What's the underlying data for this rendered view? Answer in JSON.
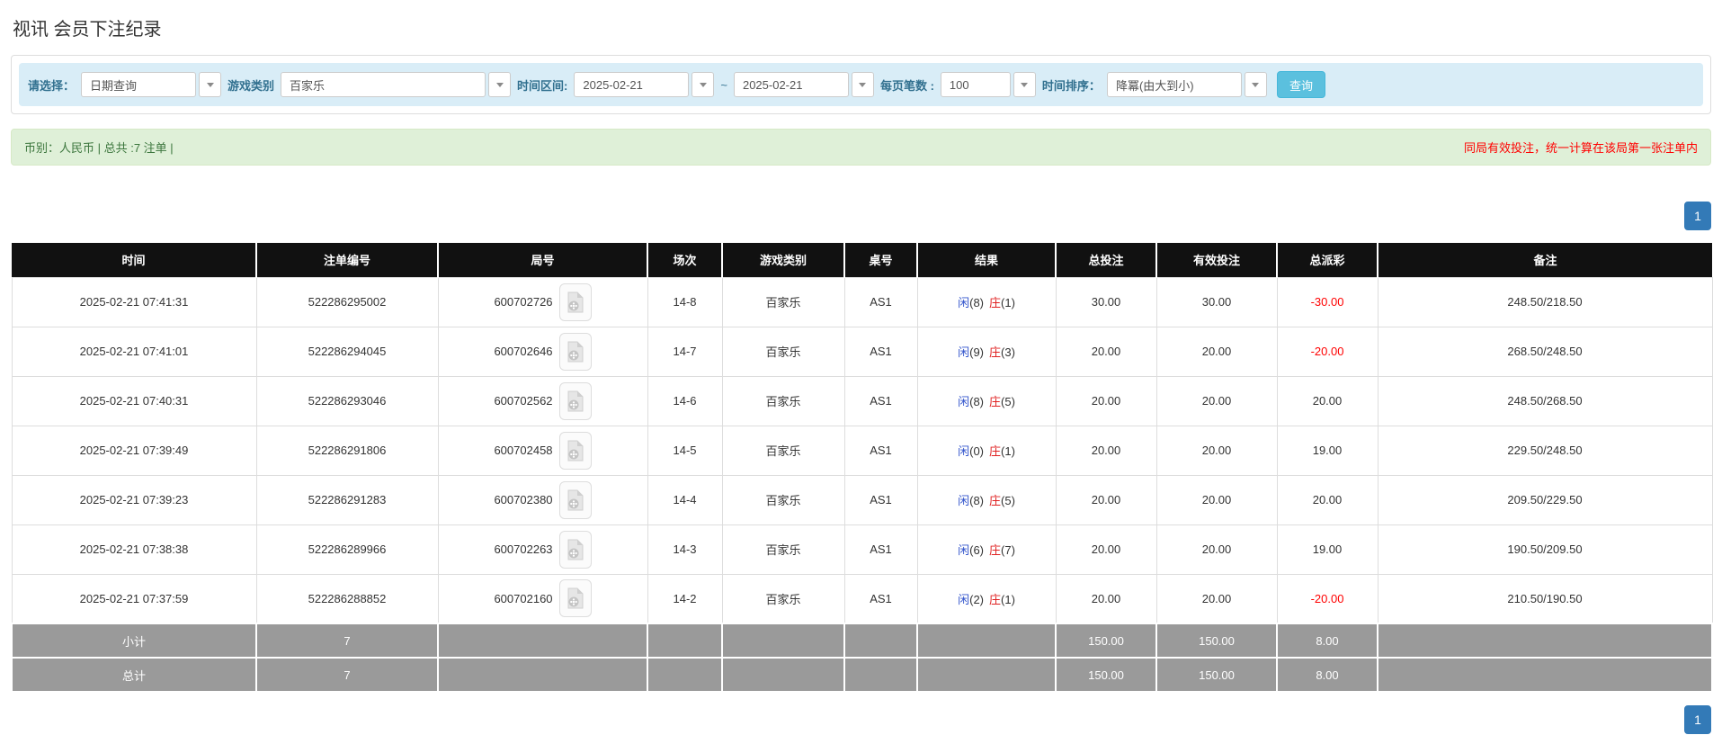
{
  "page": {
    "title": "视讯 会员下注纪录"
  },
  "filters": {
    "select_label": "请选择：",
    "select_value": "日期查询",
    "game_type_label": "游戏类别",
    "game_type_value": "百家乐",
    "time_range_label": "时间区间:",
    "date_from": "2025-02-21",
    "range_separator": "~",
    "date_to": "2025-02-21",
    "page_size_label": "每页笔数 :",
    "page_size_value": "100",
    "sort_label": "时间排序：",
    "sort_value": "降冪(由大到小)",
    "search_button": "查询"
  },
  "summary": {
    "left_text": "币别：人民币 | 总共 :7 注单 |",
    "right_notice": "同局有效投注，统一计算在该局第一张注单内"
  },
  "pagination": {
    "page": "1"
  },
  "colors": {
    "filter_bg": "#d9edf7",
    "filter_label": "#31708f",
    "search_button": "#5bc0de",
    "summary_bg": "#dff0d8",
    "summary_text": "#3c763d",
    "notice_red": "#ff0000",
    "header_bg": "#111111",
    "footer_bg": "#9a9a9a",
    "pager_blue": "#337ab7",
    "bet_amount_blue": "#1d7de2",
    "player_blue": "#3355cc",
    "banker_red": "#e02222",
    "negative_red": "#ff0000"
  },
  "table": {
    "headers": [
      "时间",
      "注单编号",
      "局号",
      "场次",
      "游戏类别",
      "桌号",
      "结果",
      "总投注",
      "有效投注",
      "总派彩",
      "备注"
    ],
    "rows": [
      {
        "time": "2025-02-21 07:41:31",
        "bet_id": "522286295002",
        "round_id": "600702726",
        "session": "14-8",
        "game": "百家乐",
        "table_no": "AS1",
        "p_label": "闲",
        "p_num": "(8)",
        "b_label": "庄",
        "b_num": "(1)",
        "total_bet": "30.00",
        "valid_bet": "30.00",
        "payout": "-30.00",
        "note": "248.50/218.50"
      },
      {
        "time": "2025-02-21 07:41:01",
        "bet_id": "522286294045",
        "round_id": "600702646",
        "session": "14-7",
        "game": "百家乐",
        "table_no": "AS1",
        "p_label": "闲",
        "p_num": "(9)",
        "b_label": "庄",
        "b_num": "(3)",
        "total_bet": "20.00",
        "valid_bet": "20.00",
        "payout": "-20.00",
        "note": "268.50/248.50"
      },
      {
        "time": "2025-02-21 07:40:31",
        "bet_id": "522286293046",
        "round_id": "600702562",
        "session": "14-6",
        "game": "百家乐",
        "table_no": "AS1",
        "p_label": "闲",
        "p_num": "(8)",
        "b_label": "庄",
        "b_num": "(5)",
        "total_bet": "20.00",
        "valid_bet": "20.00",
        "payout": "20.00",
        "note": "248.50/268.50"
      },
      {
        "time": "2025-02-21 07:39:49",
        "bet_id": "522286291806",
        "round_id": "600702458",
        "session": "14-5",
        "game": "百家乐",
        "table_no": "AS1",
        "p_label": "闲",
        "p_num": "(0)",
        "b_label": "庄",
        "b_num": "(1)",
        "total_bet": "20.00",
        "valid_bet": "20.00",
        "payout": "19.00",
        "note": "229.50/248.50"
      },
      {
        "time": "2025-02-21 07:39:23",
        "bet_id": "522286291283",
        "round_id": "600702380",
        "session": "14-4",
        "game": "百家乐",
        "table_no": "AS1",
        "p_label": "闲",
        "p_num": "(8)",
        "b_label": "庄",
        "b_num": "(5)",
        "total_bet": "20.00",
        "valid_bet": "20.00",
        "payout": "20.00",
        "note": "209.50/229.50"
      },
      {
        "time": "2025-02-21 07:38:38",
        "bet_id": "522286289966",
        "round_id": "600702263",
        "session": "14-3",
        "game": "百家乐",
        "table_no": "AS1",
        "p_label": "闲",
        "p_num": "(6)",
        "b_label": "庄",
        "b_num": "(7)",
        "total_bet": "20.00",
        "valid_bet": "20.00",
        "payout": "19.00",
        "note": "190.50/209.50"
      },
      {
        "time": "2025-02-21 07:37:59",
        "bet_id": "522286288852",
        "round_id": "600702160",
        "session": "14-2",
        "game": "百家乐",
        "table_no": "AS1",
        "p_label": "闲",
        "p_num": "(2)",
        "b_label": "庄",
        "b_num": "(1)",
        "total_bet": "20.00",
        "valid_bet": "20.00",
        "payout": "-20.00",
        "note": "210.50/190.50"
      }
    ],
    "subtotal": {
      "label": "小计",
      "count": "7",
      "total_bet": "150.00",
      "valid_bet": "150.00",
      "payout": "8.00"
    },
    "total": {
      "label": "总计",
      "count": "7",
      "total_bet": "150.00",
      "valid_bet": "150.00",
      "payout": "8.00"
    }
  }
}
